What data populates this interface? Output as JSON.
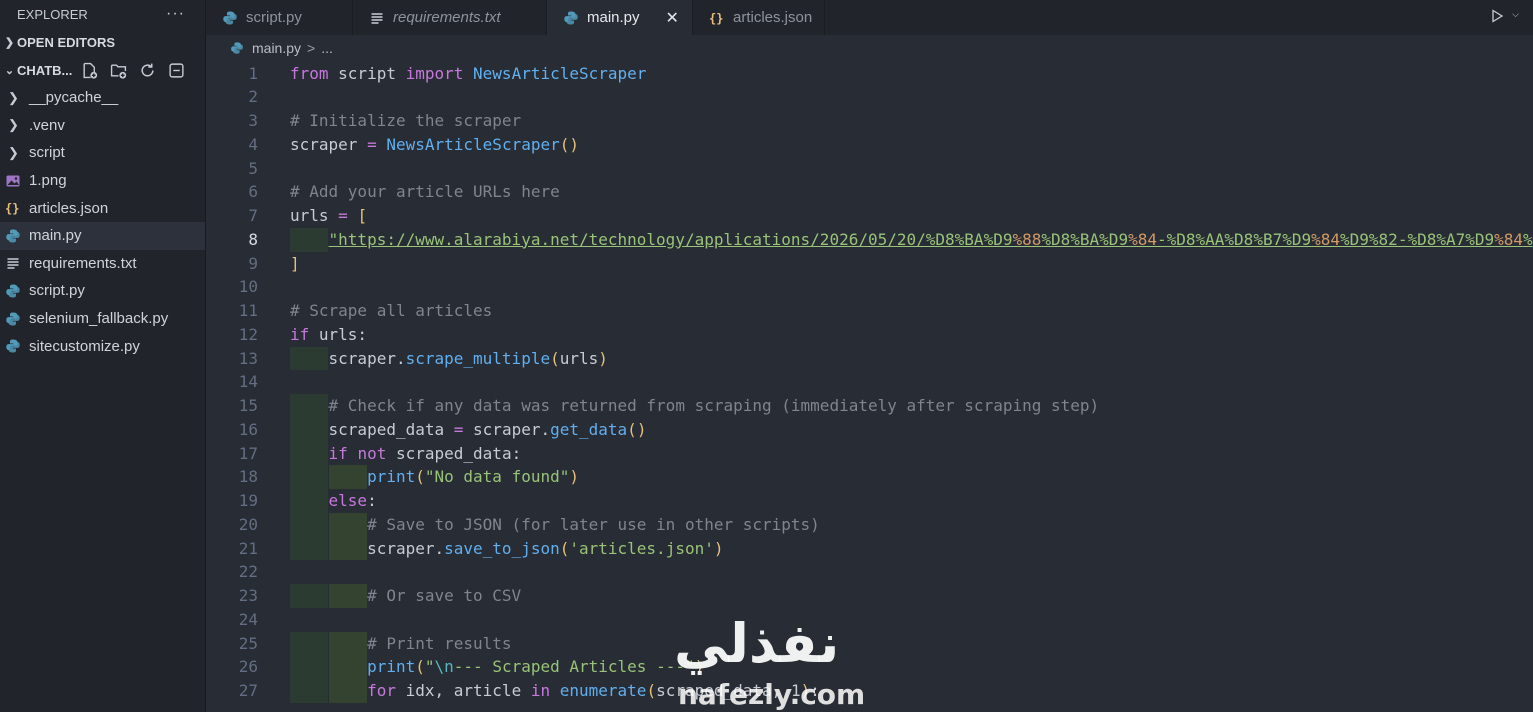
{
  "sidebar": {
    "title": "EXPLORER",
    "more": "···",
    "open_editors": "OPEN EDITORS",
    "project": "CHATB...",
    "items": [
      {
        "label": "__pycache__",
        "type": "folder"
      },
      {
        "label": ".venv",
        "type": "folder"
      },
      {
        "label": "script",
        "type": "folder"
      },
      {
        "label": "1.png",
        "type": "image"
      },
      {
        "label": "articles.json",
        "type": "json"
      },
      {
        "label": "main.py",
        "type": "python",
        "active": true
      },
      {
        "label": "requirements.txt",
        "type": "text"
      },
      {
        "label": "script.py",
        "type": "python"
      },
      {
        "label": "selenium_fallback.py",
        "type": "python"
      },
      {
        "label": "sitecustomize.py",
        "type": "python"
      }
    ]
  },
  "tabs": [
    {
      "label": "script.py",
      "icon": "python-icon"
    },
    {
      "label": "requirements.txt",
      "icon": "lines-icon"
    },
    {
      "label": "main.py",
      "icon": "python-icon",
      "active": true,
      "close": "✕"
    },
    {
      "label": "articles.json",
      "icon": "braces-icon"
    }
  ],
  "breadcrumb": {
    "file": "main.py",
    "sep": ">",
    "rest": "..."
  },
  "editor": {
    "current_line": 8,
    "lines": [
      {
        "n": "1",
        "code": "from script import NewsArticleScraper"
      },
      {
        "n": "2",
        "code": ""
      },
      {
        "n": "3",
        "code": "# Initialize the scraper"
      },
      {
        "n": "4",
        "code": "scraper = NewsArticleScraper()"
      },
      {
        "n": "5",
        "code": ""
      },
      {
        "n": "6",
        "code": "# Add your article URLs here"
      },
      {
        "n": "7",
        "code": "urls = ["
      },
      {
        "n": "8",
        "code": "    \"https://www.alarabiya.net/technology/applications/2026/05/20/%D8%BA%D9%88%D8%BA%D9%84-%D8%AA%D8%B7%D9%84%D9%82-%D8%A7%D9%84%"
      },
      {
        "n": "9",
        "code": "]"
      },
      {
        "n": "10",
        "code": ""
      },
      {
        "n": "11",
        "code": "# Scrape all articles"
      },
      {
        "n": "12",
        "code": "if urls:"
      },
      {
        "n": "13",
        "code": "    scraper.scrape_multiple(urls)"
      },
      {
        "n": "14",
        "code": ""
      },
      {
        "n": "15",
        "code": "    # Check if any data was returned from scraping (immediately after scraping step)"
      },
      {
        "n": "16",
        "code": "    scraped_data = scraper.get_data()"
      },
      {
        "n": "17",
        "code": "    if not scraped_data:"
      },
      {
        "n": "18",
        "code": "        print(\"No data found\")"
      },
      {
        "n": "19",
        "code": "    else:"
      },
      {
        "n": "20",
        "code": "        # Save to JSON (for later use in other scripts)"
      },
      {
        "n": "21",
        "code": "        scraper.save_to_json('articles.json')"
      },
      {
        "n": "22",
        "code": ""
      },
      {
        "n": "23",
        "code": "        # Or save to CSV"
      },
      {
        "n": "24",
        "code": ""
      },
      {
        "n": "25",
        "code": "        # Print results"
      },
      {
        "n": "26",
        "code": "        print(\"\\n--- Scraped Articles ---\")"
      },
      {
        "n": "27",
        "code": "        for idx, article in enumerate(scraped_data, 1):"
      }
    ]
  },
  "watermark": {
    "arabic": "نفذلي",
    "latin": "nafezly.com"
  },
  "colors": {
    "keyword": "#c678dd",
    "function": "#61afef",
    "string": "#98c379",
    "comment": "#7f848e",
    "bracket": "#e5c07b",
    "editor_bg": "#282c34",
    "sidebar_bg": "#21252b"
  }
}
